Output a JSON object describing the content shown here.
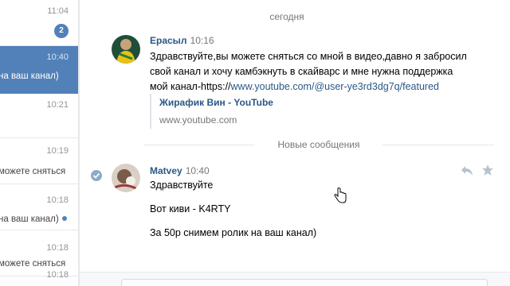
{
  "conversation_list": {
    "rows": [
      {
        "time": "11:04",
        "badge": "2",
        "snippet": ""
      },
      {
        "time": "10:40",
        "snippet": "на ваш канал)"
      },
      {
        "time": "10:21",
        "snippet": ""
      },
      {
        "time": "10:19",
        "snippet": "можете сняться"
      },
      {
        "time": "10:18",
        "snippet": "на ваш канал)"
      },
      {
        "time": "10:18",
        "snippet": "можете сняться"
      },
      {
        "time": "10:18",
        "snippet": ""
      }
    ]
  },
  "chat": {
    "date_separator": "сегодня",
    "message1": {
      "author": "Ерасыл",
      "time": "10:16",
      "text_part": "Здравствуйте,вы можете сняться со мной в видео,давно я забросил свой канал и хочу камбэкнуть в скайварс и мне нужна поддержка мой канал-https://",
      "link_text": "www.youtube.com/@user-ye3rd3dg7q/featured",
      "preview_title": "Жирафик Вин - YouTube",
      "preview_url": "www.youtube.com"
    },
    "new_messages_label": "Новые сообщения",
    "message2": {
      "author": "Matvey",
      "time": "10:40",
      "lines": [
        "Здравствуйте",
        "Вот киви - K4RTY",
        "За 50р снимем ролик на ваш канал)"
      ]
    }
  },
  "colors": {
    "accent": "#5181b8",
    "link": "#2a5885",
    "muted": "#777777"
  }
}
